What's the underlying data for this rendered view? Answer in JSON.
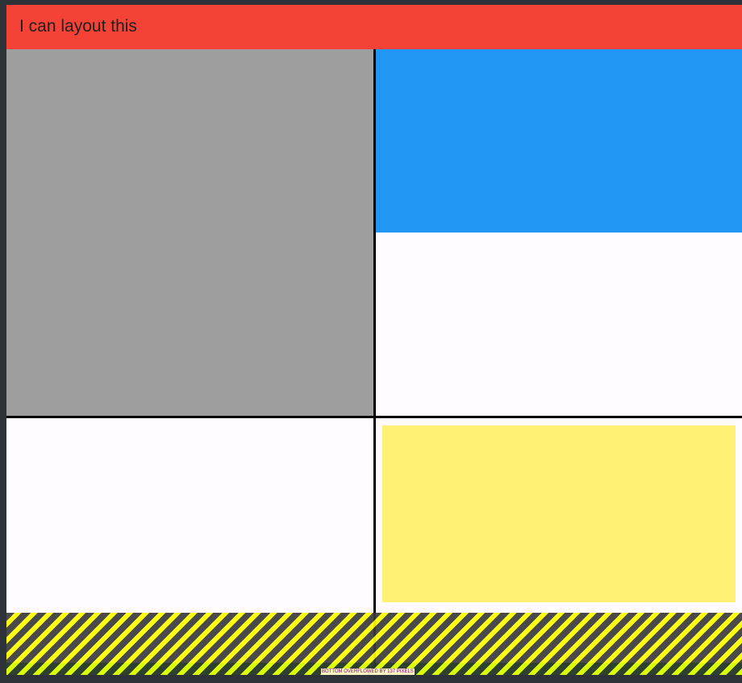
{
  "app": {
    "title": "I can layout this"
  },
  "colors": {
    "appbar": "#f44336",
    "grey_cell": "#9e9e9e",
    "blue_cell": "#2196f3",
    "yellow_cell": "#fff176",
    "divider": "#000000",
    "background": "#fffbfe"
  },
  "overflow": {
    "message": "BOTTOM OVERFLOWED BY 137 PIXELS"
  }
}
